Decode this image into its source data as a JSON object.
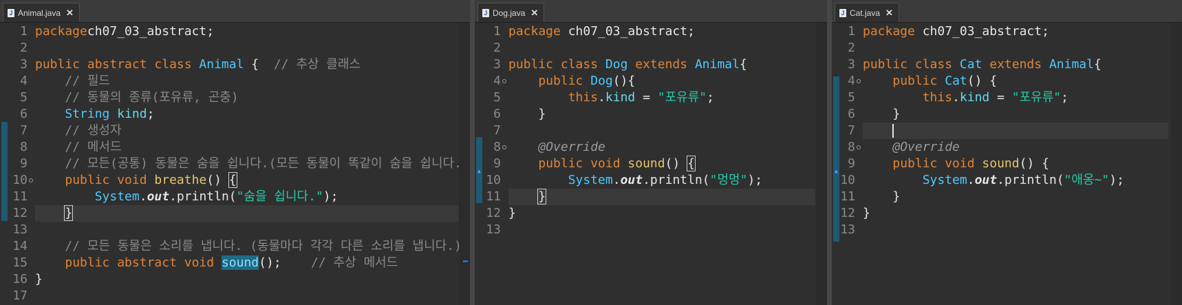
{
  "editors": [
    {
      "tab_label": "Animal.java",
      "lines": [
        [
          [
            "kw",
            "package"
          ],
          [
            "",
            "ch07_03_abstract;"
          ]
        ],
        [],
        [
          [
            "kw",
            "public abstract class"
          ],
          [
            "",
            " "
          ],
          [
            "cls",
            "Animal"
          ],
          [
            "",
            " {  "
          ],
          [
            "cmt",
            "// 추상 클래스"
          ]
        ],
        [
          [
            "",
            "    "
          ],
          [
            "cmt",
            "// 필드"
          ]
        ],
        [
          [
            "",
            "    "
          ],
          [
            "cmt",
            "// 동물의 종류(포유류, 곤충)"
          ]
        ],
        [
          [
            "",
            "    "
          ],
          [
            "cls",
            "String"
          ],
          [
            "",
            " "
          ],
          [
            "fld",
            "kind"
          ],
          [
            "",
            ";"
          ]
        ],
        [
          [
            "",
            "    "
          ],
          [
            "cmt",
            "// 생성자"
          ]
        ],
        [
          [
            "",
            "    "
          ],
          [
            "cmt",
            "// 메서드"
          ]
        ],
        [
          [
            "",
            "    "
          ],
          [
            "cmt",
            "// 모든(공통) 동물은 숨을 쉽니다.(모든 동물이 똑같이 숨을 쉽니다.)"
          ]
        ],
        [
          [
            "",
            "    "
          ],
          [
            "kw",
            "public void"
          ],
          [
            "",
            " "
          ],
          [
            "meth",
            "breathe"
          ],
          [
            "",
            "() "
          ],
          [
            "box",
            "{"
          ]
        ],
        [
          [
            "",
            "        "
          ],
          [
            "cls",
            "System"
          ],
          [
            "",
            "."
          ],
          [
            "sout",
            "out"
          ],
          [
            "",
            ".println("
          ],
          [
            "str",
            "\"숨을 쉽니다.\""
          ],
          [
            "",
            ");"
          ]
        ],
        [
          [
            "",
            "    "
          ],
          [
            "box",
            "}"
          ]
        ],
        [],
        [
          [
            "",
            "    "
          ],
          [
            "cmt",
            "// 모든 동물은 소리를 냅니다. (동물마다 각각 다른 소리를 냅니다.)"
          ]
        ],
        [
          [
            "",
            "    "
          ],
          [
            "kw",
            "public abstract void"
          ],
          [
            "",
            " "
          ],
          [
            "hl",
            "sound"
          ],
          [
            "",
            "();    "
          ],
          [
            "cmt",
            "// 추상 메서드"
          ]
        ],
        [
          [
            "",
            "}"
          ]
        ],
        []
      ]
    },
    {
      "tab_label": "Dog.java",
      "lines": [
        [
          [
            "kw",
            "package"
          ],
          [
            "",
            " ch07_03_abstract;"
          ]
        ],
        [],
        [
          [
            "kw",
            "public class"
          ],
          [
            "",
            " "
          ],
          [
            "cls",
            "Dog"
          ],
          [
            "",
            " "
          ],
          [
            "kw",
            "extends"
          ],
          [
            "",
            " "
          ],
          [
            "cls",
            "Animal"
          ],
          [
            "",
            "{"
          ]
        ],
        [
          [
            "",
            "    "
          ],
          [
            "kw",
            "public"
          ],
          [
            "",
            " "
          ],
          [
            "cls",
            "Dog"
          ],
          [
            "",
            "(){"
          ]
        ],
        [
          [
            "",
            "        "
          ],
          [
            "kw",
            "this"
          ],
          [
            "",
            "."
          ],
          [
            "fld",
            "kind"
          ],
          [
            "",
            " = "
          ],
          [
            "str",
            "\"포유류\""
          ],
          [
            "",
            ";"
          ]
        ],
        [
          [
            "",
            "    }"
          ]
        ],
        [],
        [
          [
            "",
            "    "
          ],
          [
            "ann",
            "@Override"
          ]
        ],
        [
          [
            "",
            "    "
          ],
          [
            "kw",
            "public void"
          ],
          [
            "",
            " "
          ],
          [
            "meth",
            "sound"
          ],
          [
            "",
            "() "
          ],
          [
            "box",
            "{"
          ]
        ],
        [
          [
            "",
            "        "
          ],
          [
            "cls",
            "System"
          ],
          [
            "",
            "."
          ],
          [
            "sout",
            "out"
          ],
          [
            "",
            ".println("
          ],
          [
            "str",
            "\"멍멍\""
          ],
          [
            "",
            ");"
          ]
        ],
        [
          [
            "",
            "    "
          ],
          [
            "box",
            "}"
          ]
        ],
        [
          [
            "",
            "}"
          ]
        ],
        []
      ]
    },
    {
      "tab_label": "Cat.java",
      "lines": [
        [
          [
            "kw",
            "package"
          ],
          [
            "",
            " ch07_03_abstract;"
          ]
        ],
        [],
        [
          [
            "kw",
            "public class"
          ],
          [
            "",
            " "
          ],
          [
            "cls",
            "Cat"
          ],
          [
            "",
            " "
          ],
          [
            "kw",
            "extends"
          ],
          [
            "",
            " "
          ],
          [
            "cls",
            "Animal"
          ],
          [
            "",
            "{"
          ]
        ],
        [
          [
            "",
            "    "
          ],
          [
            "kw",
            "public"
          ],
          [
            "",
            " "
          ],
          [
            "cls",
            "Cat"
          ],
          [
            "",
            "() {"
          ]
        ],
        [
          [
            "",
            "        "
          ],
          [
            "kw",
            "this"
          ],
          [
            "",
            "."
          ],
          [
            "fld",
            "kind"
          ],
          [
            "",
            " = "
          ],
          [
            "str",
            "\"포유류\""
          ],
          [
            "",
            ";"
          ]
        ],
        [
          [
            "",
            "    }"
          ]
        ],
        [
          [
            "",
            "    "
          ],
          [
            "caret",
            ""
          ]
        ],
        [
          [
            "",
            "    "
          ],
          [
            "ann",
            "@Override"
          ]
        ],
        [
          [
            "",
            "    "
          ],
          [
            "kw",
            "public void"
          ],
          [
            "",
            " "
          ],
          [
            "meth",
            "sound"
          ],
          [
            "",
            "() {"
          ]
        ],
        [
          [
            "",
            "        "
          ],
          [
            "cls",
            "System"
          ],
          [
            "",
            "."
          ],
          [
            "sout",
            "out"
          ],
          [
            "",
            ".println("
          ],
          [
            "str",
            "\"애옹~\""
          ],
          [
            "",
            ");"
          ]
        ],
        [
          [
            "",
            "    }"
          ]
        ],
        [
          [
            "",
            "}"
          ]
        ],
        []
      ]
    }
  ]
}
